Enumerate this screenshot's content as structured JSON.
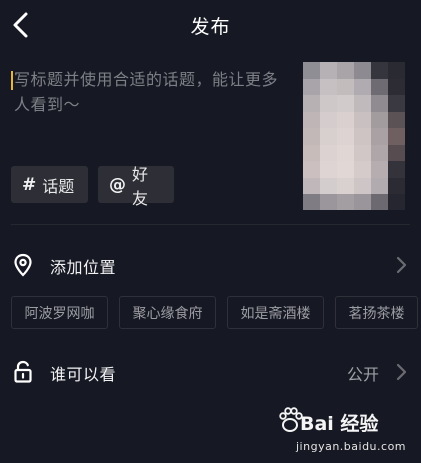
{
  "header": {
    "title": "发布",
    "back_icon": "chevron-left-icon"
  },
  "composer": {
    "placeholder": "写标题并使用合适的话题，能让更多人看到～",
    "cursor_color": "#e8b53b",
    "hashtag_button": {
      "symbol": "#",
      "label": "话题"
    },
    "mention_button": {
      "symbol": "@",
      "label": "好友"
    },
    "cover_colors": [
      [
        "#8f8e95",
        "#b6b1b5",
        "#a9a4a7",
        "#8d8a92",
        "#35353e",
        "#2a2a33"
      ],
      [
        "#a9a4a9",
        "#c6c0c3",
        "#c2bcbd",
        "#b0abb0",
        "#6f6b73",
        "#2d2c35"
      ],
      [
        "#b8b1b3",
        "#cfc8c9",
        "#d2cbcb",
        "#c1babc",
        "#8f8b90",
        "#3a3840"
      ],
      [
        "#bfb5b6",
        "#d5cdcd",
        "#d9d0cf",
        "#c9c1c1",
        "#a29c9e",
        "#5b5256"
      ],
      [
        "#c3b8b8",
        "#d8cfcf",
        "#ddd3d2",
        "#cec4c3",
        "#a9a1a3",
        "#6f5f60"
      ],
      [
        "#c8bcbb",
        "#dcd2d1",
        "#e0d6d4",
        "#d1c7c6",
        "#aea6a8",
        "#574c4f"
      ],
      [
        "#cbc0bf",
        "#ddd4d3",
        "#e1d8d6",
        "#d4cbca",
        "#b5adaf",
        "#34323a"
      ],
      [
        "#bfb7ba",
        "#d4cdcd",
        "#d9d1d0",
        "#cec6c6",
        "#b1aaae",
        "#2c2b33"
      ],
      [
        "#7f7c84",
        "#9a969b",
        "#a39ea2",
        "#9a959a",
        "#6c6971",
        "#262630"
      ]
    ]
  },
  "location": {
    "icon": "location-pin-icon",
    "label": "添加位置",
    "chips": [
      "阿波罗网咖",
      "聚心缘食府",
      "如是斋酒楼",
      "茗扬茶楼"
    ]
  },
  "visibility": {
    "icon": "unlock-icon",
    "label": "谁可以看",
    "value": "公开"
  },
  "watermark": {
    "brand": "Bai 经验",
    "url": "jingyan.baidu.com"
  }
}
